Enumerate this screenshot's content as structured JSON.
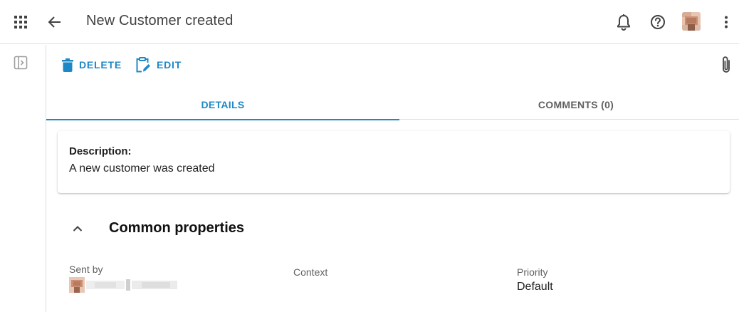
{
  "header": {
    "title": "New Customer created",
    "icons": {
      "apps": "apps-grid-icon",
      "back": "arrow-left-icon",
      "notifications": "bell-icon",
      "help": "help-circle-icon",
      "more": "more-vertical-icon"
    }
  },
  "sidebar": {
    "toggle_icon": "sidebar-panel-icon"
  },
  "toolbar": {
    "delete_label": "DELETE",
    "edit_label": "EDIT",
    "attach_icon": "paperclip-icon"
  },
  "tabs": [
    {
      "label": "DETAILS",
      "active": true
    },
    {
      "label": "COMMENTS (0)",
      "active": false
    }
  ],
  "description": {
    "label": "Description:",
    "text": "A new customer was created"
  },
  "section": {
    "title": "Common properties",
    "expanded": true
  },
  "properties": {
    "sent_by": {
      "label": "Sent by"
    },
    "context": {
      "label": "Context",
      "value": ""
    },
    "priority": {
      "label": "Priority",
      "value": "Default"
    }
  },
  "colors": {
    "accent": "#1e88c7",
    "divider": "#e0e0e0",
    "text_primary": "#212121",
    "text_secondary": "#616161"
  }
}
